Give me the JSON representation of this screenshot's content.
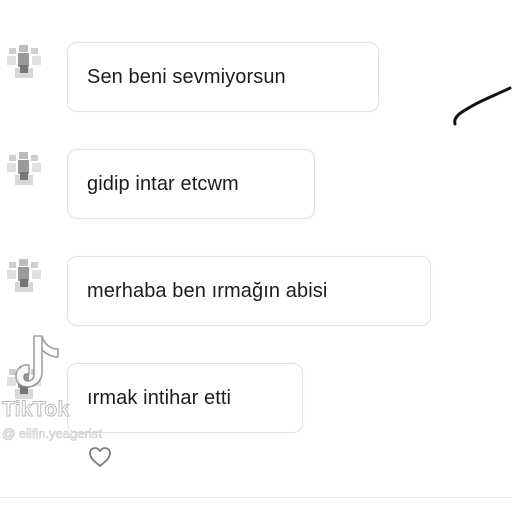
{
  "messages": [
    {
      "text": "Sen beni sevmiyorsun"
    },
    {
      "text": "gidip intar etcwm"
    },
    {
      "text": "merhaba ben ırmağın abisi"
    },
    {
      "text": "ırmak intihar etti"
    }
  ],
  "watermark": {
    "brand": "TikTok",
    "username": "@ elifin.yeagerist",
    "logo_icon": "tiktok-logo-icon"
  },
  "icons": {
    "avatar": "avatar-icon",
    "like": "heart-icon",
    "annotation": "pen-stroke"
  },
  "colors": {
    "background": "#ffffff",
    "bubble_border": "#e2e2e2",
    "text": "#1c1c1c"
  }
}
